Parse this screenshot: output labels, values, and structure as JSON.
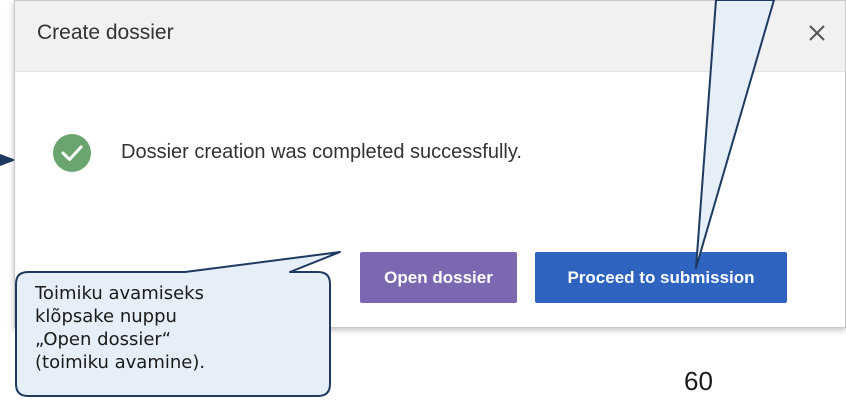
{
  "dialog": {
    "title": "Create dossier",
    "close_icon": "close-icon",
    "status_icon": "check-circle-icon",
    "status_color": "#6aa56f",
    "message": "Dossier creation was completed successfully.",
    "buttons": {
      "open_label": "Open dossier",
      "open_color": "#7b68b0",
      "proceed_label": "Proceed to submission",
      "proceed_color": "#2e64bf"
    }
  },
  "callout": {
    "lines": [
      "Toimiku avamiseks",
      "klõpsake nuppu",
      "„Open dossier“",
      "(toimiku avamine)."
    ],
    "fill": "#e6eff8",
    "border": "#1f3a60"
  },
  "page_number": "60"
}
